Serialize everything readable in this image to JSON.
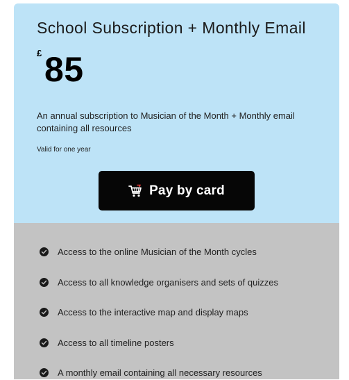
{
  "plan": {
    "title": "School Subscription + Monthly Email",
    "currency_symbol": "£",
    "price": "85",
    "description": "An annual subscription to Musician of the Month + Monthly email containing all resources",
    "validity": "Valid for one year"
  },
  "pay_button": {
    "label": "Pay by card",
    "icon": "shopping-cart-icon"
  },
  "features": [
    "Access to the online Musician of the Month cycles",
    "Access to all knowledge organisers and sets of quizzes",
    "Access to the interactive map and display maps",
    "Access to all timeline posters",
    "A monthly email containing all necessary resources"
  ],
  "colors": {
    "card_top_background": "#bde3f7",
    "card_bottom_background": "#c3c3c3",
    "button_background": "#060606",
    "button_text": "#ffffff",
    "check_icon": "#1a1a1a"
  }
}
